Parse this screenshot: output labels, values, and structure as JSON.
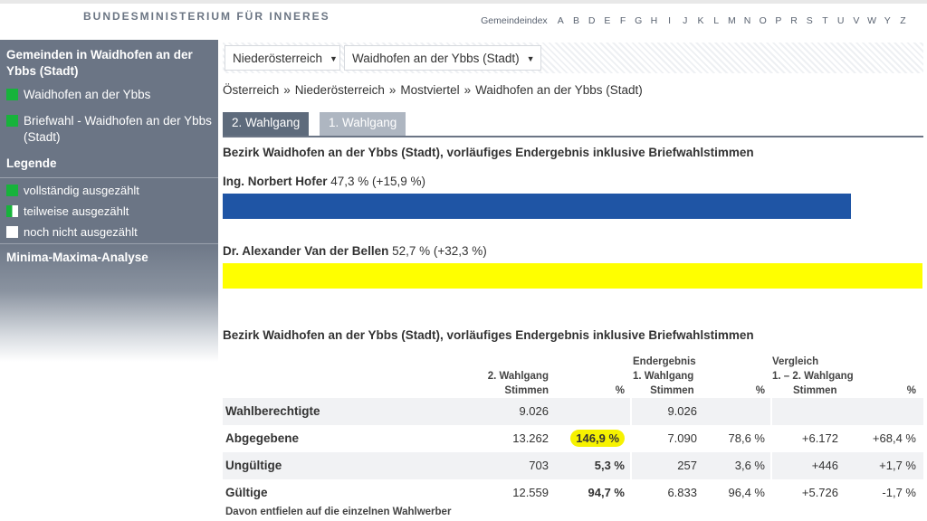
{
  "header": {
    "ministry": "BUNDESMINISTERIUM FÜR INNERES",
    "index_label": "Gemeindeindex",
    "letters": [
      "A",
      "B",
      "D",
      "E",
      "F",
      "G",
      "H",
      "I",
      "J",
      "K",
      "L",
      "M",
      "N",
      "O",
      "P",
      "R",
      "S",
      "T",
      "U",
      "V",
      "W",
      "Y",
      "Z"
    ]
  },
  "sidebar": {
    "section_title": "Gemeinden in Waidhofen an der Ybbs (Stadt)",
    "items": [
      {
        "label": "Waidhofen an der Ybbs",
        "status": "green"
      },
      {
        "label": "Briefwahl - Waidhofen an der Ybbs (Stadt)",
        "status": "green"
      }
    ],
    "legend_title": "Legende",
    "legend": [
      {
        "label": "vollständig ausgezählt",
        "status": "green"
      },
      {
        "label": "teilweise ausgezählt",
        "status": "half"
      },
      {
        "label": "noch nicht ausgezählt",
        "status": "white"
      }
    ],
    "analysis": "Minima-Maxima-Analyse"
  },
  "selects": {
    "state": "Niederösterreich",
    "district": "Waidhofen an der Ybbs (Stadt)"
  },
  "breadcrumb": [
    "Österreich",
    "Niederösterreich",
    "Mostviertel",
    "Waidhofen an der Ybbs (Stadt)"
  ],
  "breadcrumb_sep": "»",
  "tabs": {
    "second": "2. Wahlgang",
    "first": "1. Wahlgang"
  },
  "result_heading": "Bezirk Waidhofen an der Ybbs (Stadt), vorläufiges Endergebnis inklusive Briefwahlstimmen",
  "candidates": [
    {
      "name": "Ing. Norbert Hofer",
      "pct_text": "47,3 % (+15,9 %)",
      "share": 47.3,
      "color": "#1f55a5"
    },
    {
      "name": "Dr. Alexander Van der Bellen",
      "pct_text": "52,7 % (+32,3 %)",
      "share": 52.7,
      "color": "#ffff00"
    }
  ],
  "table": {
    "heading": "Bezirk Waidhofen an der Ybbs (Stadt), vorläufiges Endergebnis inklusive Briefwahlstimmen",
    "head": {
      "g2_line1": "2. Wahlgang",
      "g2_line2": "Stimmen",
      "pct": "%",
      "end_line0": "Endergebnis",
      "end_line1": "1. Wahlgang",
      "end_line2": "Stimmen",
      "pct2": "%",
      "cmp_line0": "Vergleich",
      "cmp_line1": "1. – 2. Wahlgang",
      "cmp_line2": "Stimmen",
      "pct3": "%"
    },
    "rows": [
      {
        "label": "Wahlberechtigte",
        "v2": "9.026",
        "p2": "",
        "v1": "9.026",
        "p1": "",
        "dv": "",
        "dp": ""
      },
      {
        "label": "Abgegebene",
        "v2": "13.262",
        "p2": "146,9 %",
        "v1": "7.090",
        "p1": "78,6 %",
        "dv": "+6.172",
        "dp": "+68,4 %"
      },
      {
        "label": "Ungültige",
        "v2": "703",
        "p2": "5,3 %",
        "v1": "257",
        "p1": "3,6 %",
        "dv": "+446",
        "dp": "+1,7 %"
      },
      {
        "label": "Gültige",
        "v2": "12.559",
        "p2": "94,7 %",
        "v1": "6.833",
        "p1": "96,4 %",
        "dv": "+5.726",
        "dp": "-1,7 %"
      }
    ],
    "note": "Davon entfielen auf die einzelnen Wahlwerber"
  }
}
